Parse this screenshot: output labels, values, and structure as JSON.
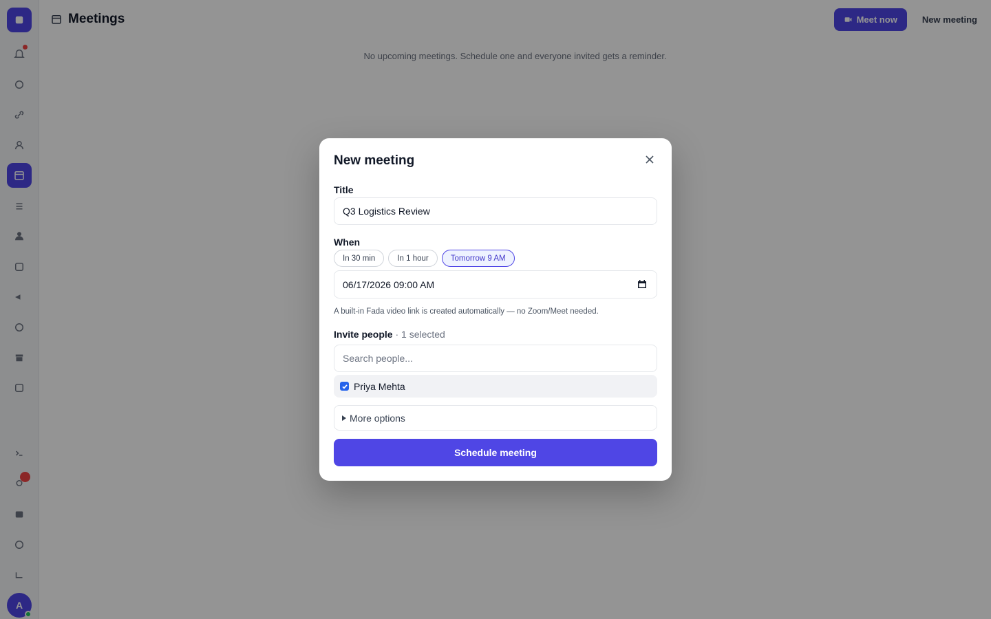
{
  "app": {
    "page_title": "Meetings",
    "meet_now_label": "Meet now",
    "new_meeting_link": "New meeting",
    "empty_state": "No upcoming meetings. Schedule one and everyone invited gets a reminder.",
    "avatar_initial": "A",
    "accent_color": "#4f46e5",
    "sidebar_icons": [
      "home-icon",
      "bell-icon",
      "chat-icon",
      "link-icon",
      "user-icon",
      "calendar-icon",
      "list-icon",
      "users-icon",
      "grid-icon",
      "bolt-icon",
      "clock-icon",
      "archive-icon",
      "settings-icon",
      "expand-icon",
      "notification-icon",
      "stack-icon",
      "help-icon",
      "logout-icon"
    ]
  },
  "modal": {
    "title": "New meeting",
    "title_label": "Title",
    "title_value": "Q3 Logistics Review",
    "when_label": "When",
    "chips": [
      "In 30 min",
      "In 1 hour",
      "Tomorrow 9 AM"
    ],
    "selected_chip": "Tomorrow 9 AM",
    "datetime_value": "06/17/2026 09:00 AM",
    "hint": "A built-in Fada video link is created automatically — no Zoom/Meet needed.",
    "invite_label": "Invite people",
    "invite_count": "· 1 selected",
    "search_placeholder": "Search people...",
    "people": [
      {
        "name": "Priya Mehta",
        "checked": true
      }
    ],
    "more_options": "More options",
    "submit_label": "Schedule meeting"
  }
}
